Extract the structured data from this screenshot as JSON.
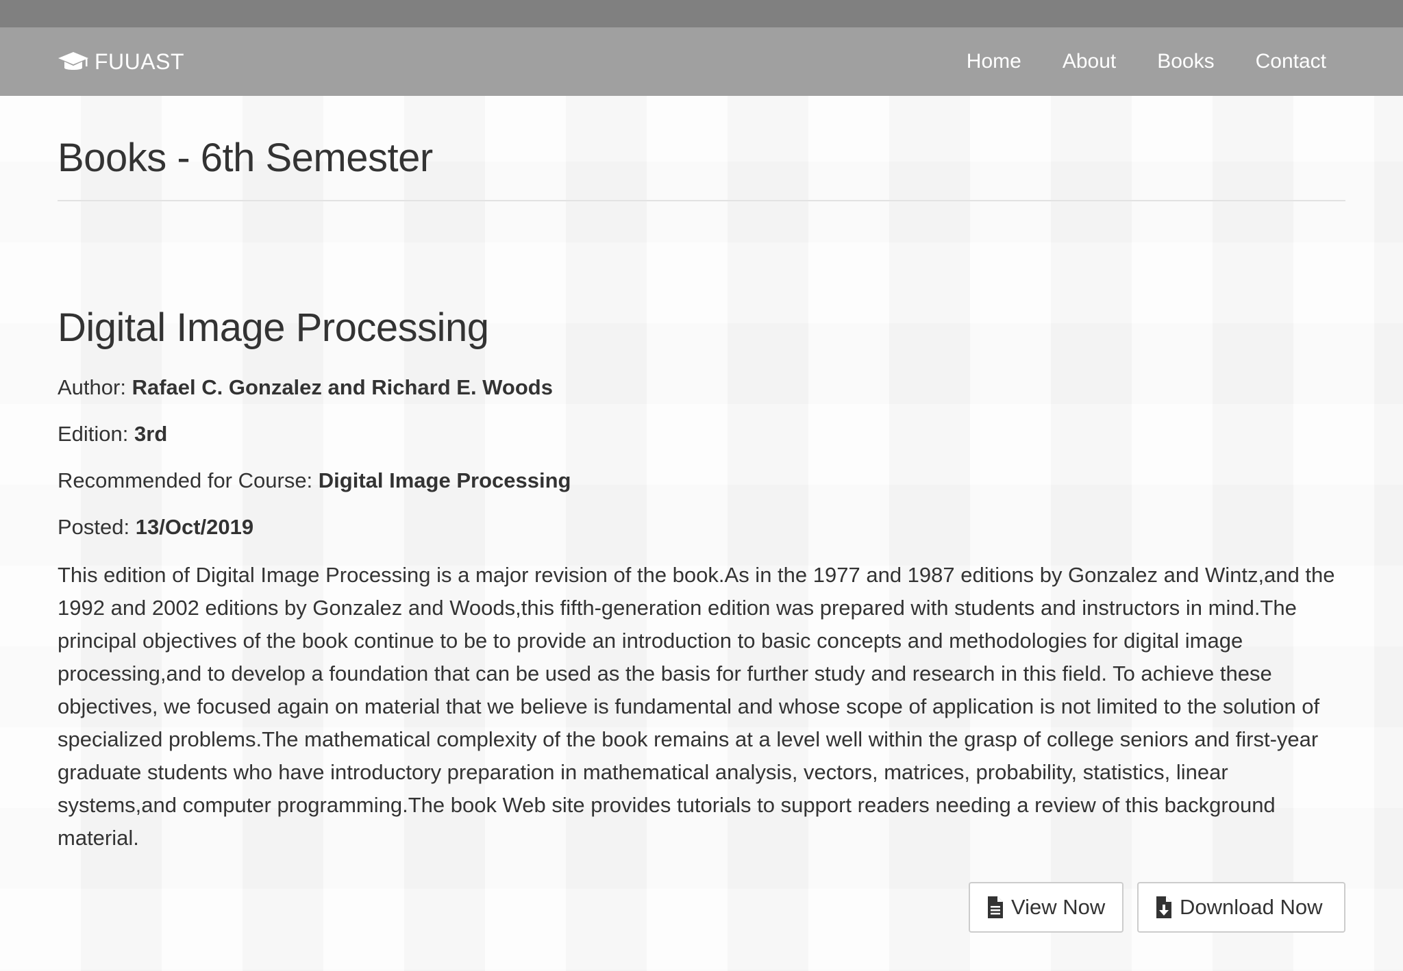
{
  "navbar": {
    "brand_icon": "graduation-cap-icon",
    "brand": "FUUAST",
    "links": [
      {
        "label": "Home"
      },
      {
        "label": "About"
      },
      {
        "label": "Books"
      },
      {
        "label": "Contact"
      }
    ]
  },
  "page": {
    "title": "Books - 6th Semester"
  },
  "book": {
    "title": "Digital Image Processing",
    "author_label": "Author: ",
    "author": "Rafael C. Gonzalez and Richard E. Woods",
    "edition_label": "Edition: ",
    "edition": "3rd",
    "course_label": "Recommended for Course: ",
    "course": "Digital Image Processing",
    "posted_label": "Posted: ",
    "posted": "13/Oct/2019",
    "description": "This edition of Digital Image Processing is a major revision of the book.As in the 1977 and 1987 editions by Gonzalez and Wintz,and the 1992 and 2002 editions by Gonzalez and Woods,this fifth-generation edition was prepared with students and instructors in mind.The principal objectives of the book continue to be to provide an introduction to basic concepts and methodologies for digital image processing,and to develop a foundation that can be used as the basis for further study and research in this field. To achieve these objectives, we focused again on material that we believe is fundamental and whose scope of application is not limited to the solution of specialized problems.The mathematical complexity of the book remains at a level well within the grasp of college seniors and first-year graduate students who have introductory preparation in mathematical analysis, vectors, matrices, probability, statistics, linear systems,and computer programming.The book Web site provides tutorials to support readers needing a review of this background material."
  },
  "actions": {
    "view_label": "View Now",
    "view_icon": "document-icon",
    "download_label": "Download Now",
    "download_icon": "file-download-icon"
  },
  "colors": {
    "top_strip": "#808080",
    "navbar": "#a0a0a0",
    "text": "#333333",
    "background": "#f6f6f6"
  }
}
